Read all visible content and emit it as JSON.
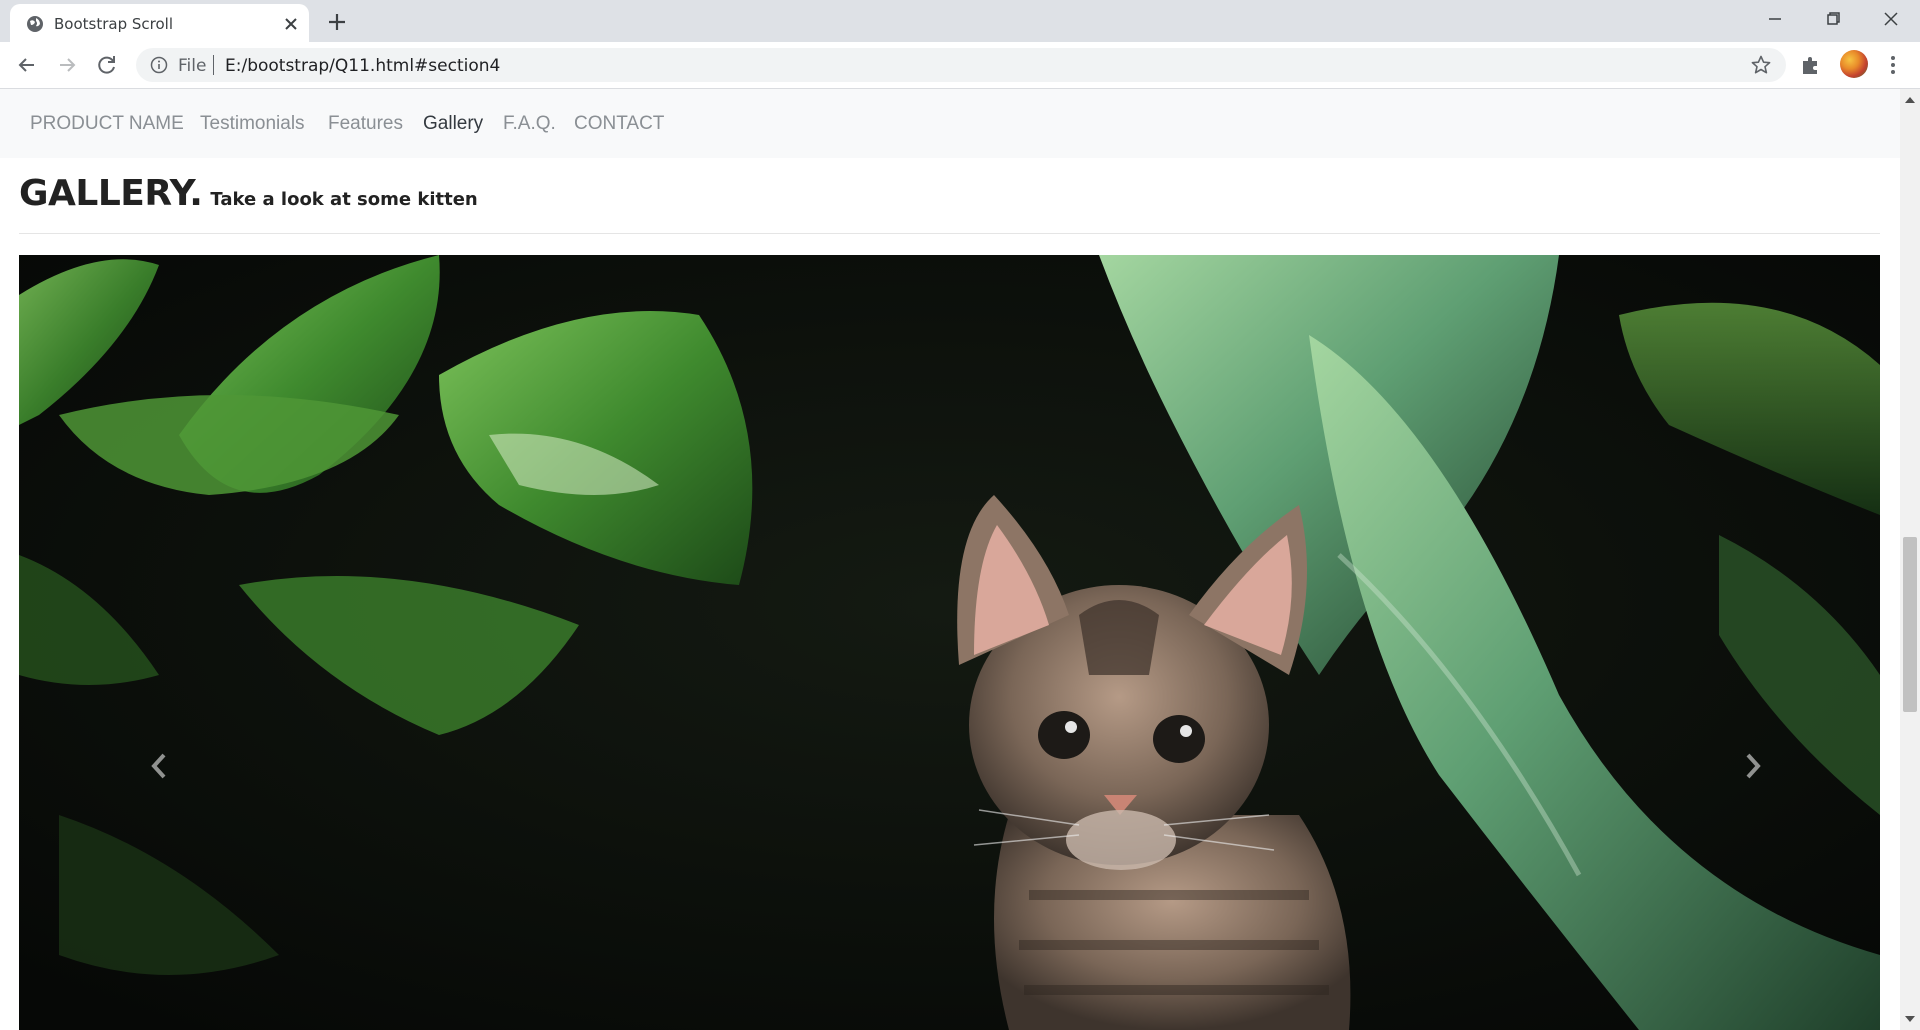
{
  "browser": {
    "tab_title": "Bootstrap Scroll",
    "scheme_label": "File",
    "url": "E:/bootstrap/Q11.html#section4"
  },
  "navbar": {
    "brand": "PRODUCT NAME",
    "links": [
      {
        "label": "Testimonials",
        "active": false
      },
      {
        "label": "Features",
        "active": false
      },
      {
        "label": "Gallery",
        "active": true
      },
      {
        "label": "F.A.Q.",
        "active": false
      },
      {
        "label": "CONTACT",
        "active": false
      }
    ]
  },
  "section": {
    "title": "GALLERY.",
    "subtitle": "Take a look at some kitten"
  },
  "carousel": {
    "image_subject": "kitten-among-leaves",
    "prev_icon": "chevron-left-icon",
    "next_icon": "chevron-right-icon"
  },
  "colors": {
    "navbar_bg": "#f8f9fa",
    "nav_link": "#8a8f94",
    "nav_link_active": "#343a40",
    "tabstrip_bg": "#dee1e6"
  }
}
